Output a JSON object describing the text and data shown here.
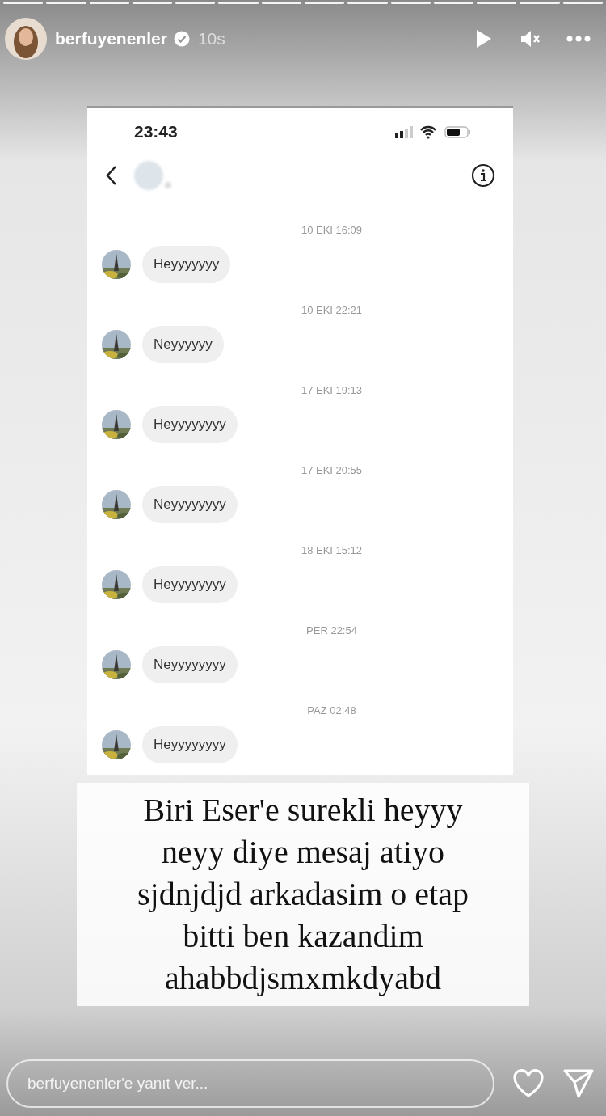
{
  "story": {
    "username": "berfuyenenler",
    "verified": true,
    "time": "10s"
  },
  "chat": {
    "status_time": "23:43",
    "messages": [
      {
        "date": "10 EKI 16:09",
        "text": "Heyyyyyyy"
      },
      {
        "date": "10 EKI 22:21",
        "text": "Neyyyyyy"
      },
      {
        "date": "17 EKI 19:13",
        "text": "Heyyyyyyyy"
      },
      {
        "date": "17 EKI 20:55",
        "text": "Neyyyyyyyy"
      },
      {
        "date": "18 EKI 15:12",
        "text": "Heyyyyyyyy"
      },
      {
        "date": "PER 22:54",
        "text": "Neyyyyyyyy"
      },
      {
        "date": "PAZ 02:48",
        "text": "Heyyyyyyyy"
      }
    ]
  },
  "caption": [
    "Biri Eser'e surekli heyyy",
    "neyy diye mesaj atiyo",
    "sjdnjdjd arkadasim o etap",
    "bitti ben kazandim",
    "ahabbdjsmxmkdyabd"
  ],
  "reply": {
    "placeholder": "berfuyenenler'e yanıt ver..."
  }
}
